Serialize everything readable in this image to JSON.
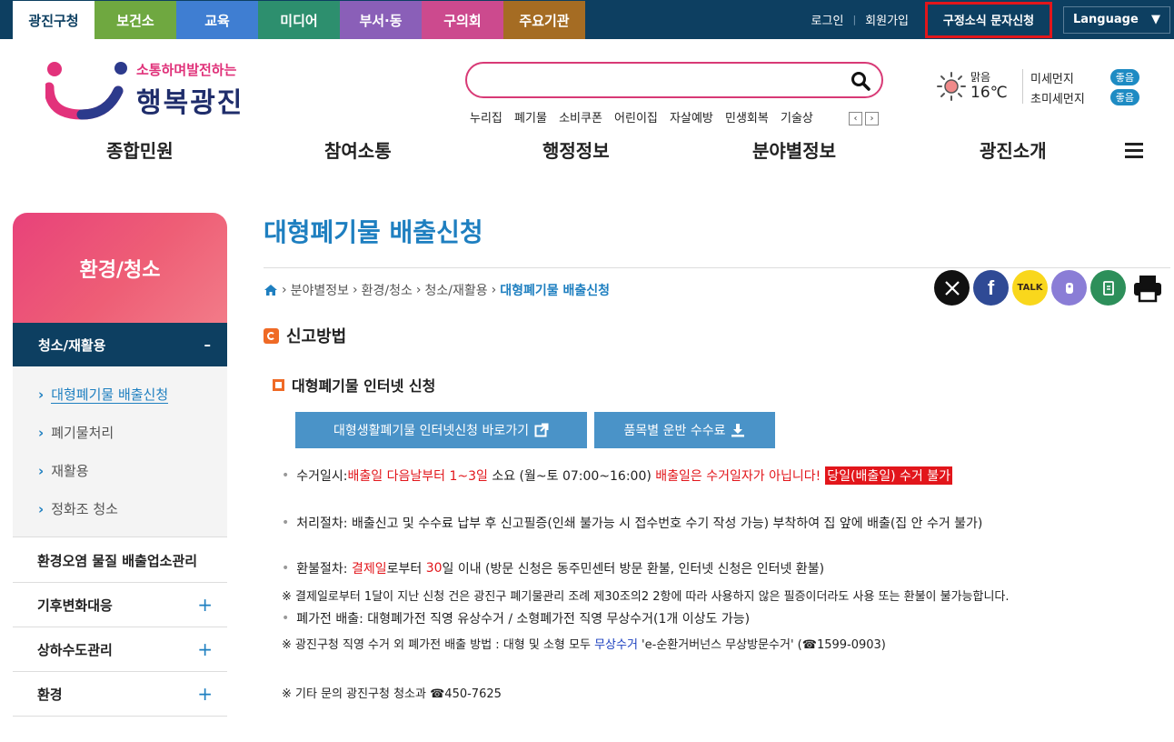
{
  "topbar": {
    "tabs": [
      "광진구청",
      "보건소",
      "교육",
      "미디어",
      "부서·동",
      "구의회",
      "주요기관"
    ],
    "tab_colors": [
      "#ffffff",
      "#6fa840",
      "#3f7ed2",
      "#2d8f6e",
      "#8a5fb8",
      "#cc4a8e",
      "#a56c23"
    ],
    "login": "로그인",
    "signup": "회원가입",
    "sms": "구정소식 문자신청",
    "language": "Language"
  },
  "header": {
    "logo_slogan": "소통하며발전하는",
    "logo_name": "행복광진",
    "keywords": [
      "누리집",
      "폐기물",
      "소비쿠폰",
      "어린이집",
      "자살예방",
      "민생회복",
      "기술상"
    ],
    "weather_label": "맑음",
    "weather_temp": "16℃",
    "dust_label": "미세먼지",
    "dust_value": "좋음",
    "ultra_label": "초미세먼지",
    "ultra_value": "좋음"
  },
  "gnb": [
    "종합민원",
    "참여소통",
    "행정정보",
    "분야별정보",
    "광진소개"
  ],
  "sidebar": {
    "title": "환경/청소",
    "active": "청소/재활용",
    "active_toggle": "–",
    "sub_items": [
      "대형폐기물 배출신청",
      "폐기물처리",
      "재활용",
      "정화조 청소"
    ],
    "menus": [
      "환경오염 물질 배출업소관리",
      "기후변화대응",
      "상하수도관리",
      "환경"
    ],
    "plus": "+"
  },
  "content": {
    "title": "대형폐기물 배출신청",
    "breadcrumb": [
      "분야별정보",
      "환경/청소",
      "청소/재활용",
      "대형폐기물 배출신청"
    ],
    "section_title": "신고방법",
    "sub_title": "대형폐기물 인터넷 신청",
    "btn_apply": "대형생활폐기물 인터넷신청 바로가기",
    "btn_fee": "품목별 운반 수수료",
    "row1_label": "수거일시: ",
    "row1_red1": "배출일 다음날부터 1~3일",
    "row1_mid": " 소요 (월~토 07:00~16:00) ",
    "row1_red2": "배출일은 수거일자가 아닙니다!",
    "row1_redbg": "당일(배출일) 수거 불가",
    "row2": "처리절차: 배출신고 및 수수료 납부 후 신고필증(인쇄 불가능 시 접수번호 수기 작성 가능) 부착하여 집 앞에 배출(집 안 수거 불가)",
    "row3_label": "환불절차: ",
    "row3_red1": "결제일",
    "row3_mid": "로부터 ",
    "row3_red2": "30",
    "row3_end": "일 이내 (방문 신청은 동주민센터 방문 환불, 인터넷 신청은 인터넷 환불)",
    "note1": "※ 결제일로부터 1달이 지난 신청 건은 광진구 폐기물관리 조례 제30조의2 2항에 따라 사용하지 않은 필증이더라도 사용 또는 환불이 불가능합니다.",
    "row4": "폐가전 배출: 대형폐가전 직영 유상수거 / 소형폐가전 직영 무상수거(1개 이상도 가능)",
    "note2_pre": "※ 광진구청 직영 수거 외 폐가전 배출 방법 : 대형 및 소형 모두 ",
    "note2_blue": "무상수거",
    "note2_post": " 'e-순환거버넌스 무상방문수거' (☎1599-0903)",
    "note3": "※ 기타 문의 광진구청 청소과 ☎450-7625"
  },
  "share": {
    "kakao": "TALK"
  }
}
